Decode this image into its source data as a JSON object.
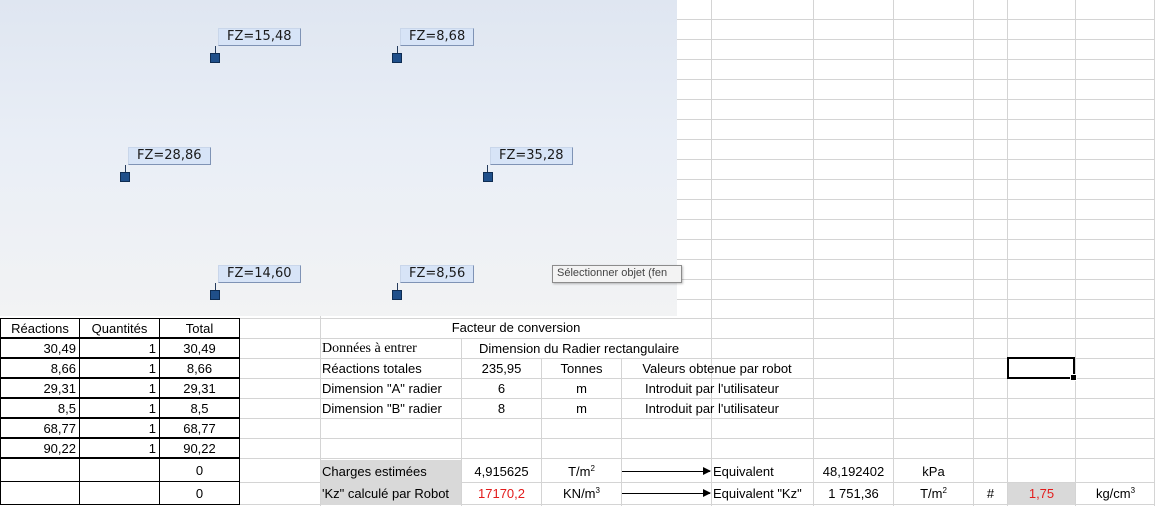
{
  "robot_view": {
    "labels": [
      "FZ=15,48",
      "FZ=8,68",
      "FZ=28,86",
      "FZ=35,28",
      "FZ=14,60",
      "FZ=8,56"
    ],
    "tooltip": "Sélectionner objet (fen"
  },
  "left_table": {
    "headers": [
      "Réactions",
      "Quantités",
      "Total"
    ],
    "rows": [
      [
        "30,49",
        "1",
        "30,49"
      ],
      [
        "8,66",
        "1",
        "8,66"
      ],
      [
        "29,31",
        "1",
        "29,31"
      ],
      [
        "8,5",
        "1",
        "8,5"
      ],
      [
        "68,77",
        "1",
        "68,77"
      ],
      [
        "90,22",
        "1",
        "90,22"
      ],
      [
        "",
        "",
        "0"
      ],
      [
        "",
        "",
        "0"
      ]
    ]
  },
  "conversion": {
    "title": "Facteur de conversion",
    "inputs_label": "Données à entrer",
    "dimension_header": "Dimension du Radier rectangulaire",
    "rows": [
      {
        "label": "Réactions totales",
        "value": "235,95",
        "unit": "Tonnes",
        "note": "Valeurs obtenue par robot"
      },
      {
        "label": "Dimension \"A\" radier",
        "value": "6",
        "unit": "m",
        "note": "Introduit par l'utilisateur"
      },
      {
        "label": "Dimension \"B\" radier",
        "value": "8",
        "unit": "m",
        "note": "Introduit par l'utilisateur"
      }
    ],
    "charges": {
      "label": "Charges estimées",
      "value": "4,915625",
      "unit": "T/m",
      "unit_sup": "2",
      "equiv_label": "Equivalent",
      "equiv_value": "48,192402",
      "equiv_unit": "kPa"
    },
    "kz": {
      "label": "'Kz\" calculé par Robot",
      "value": "17170,2",
      "unit": "KN/m",
      "unit_sup": "3",
      "equiv_label": "Equivalent \"Kz\"",
      "equiv_value": "1 751,36",
      "equiv_unit": "T/m",
      "equiv_unit_sup": "2",
      "hash": "#",
      "result": "1,75",
      "result_unit": "kg/cm",
      "result_unit_sup": "3"
    }
  },
  "colors": {
    "red_value": "#e31b1b",
    "gray_cell": "#d9d9d9",
    "node": "#1f4f8a",
    "label_bg": "#d7e4f7"
  }
}
